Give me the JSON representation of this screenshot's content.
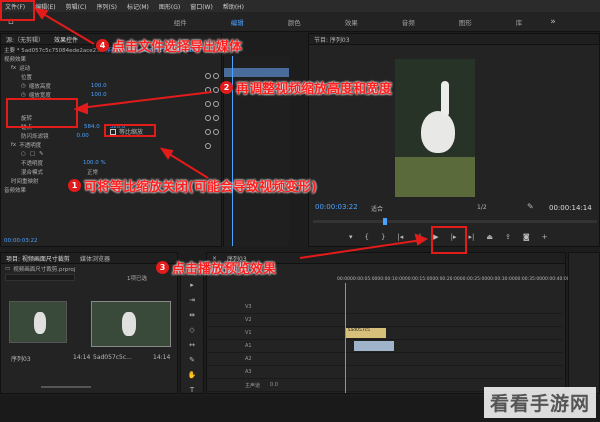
{
  "menu": [
    "文件(F)",
    "编辑(E)",
    "剪辑(C)",
    "序列(S)",
    "标记(M)",
    "图形(G)",
    "窗口(W)",
    "帮助(H)"
  ],
  "workspaces": [
    "组件",
    "编辑",
    "颜色",
    "效果",
    "音频",
    "图形",
    "库"
  ],
  "effects_panel": {
    "tab_source": "源:（无剪辑）",
    "tab_effects": "效果控件",
    "master_label": "主要 * 5ad057c5c75084ede2ace2...",
    "sequence_label": "序列 03 * 5ad057c5c75084edeb...",
    "section_video": "视频效果",
    "motion": "运动",
    "position": "位置",
    "scale_height": "缩放高度",
    "scale_width": "缩放宽度",
    "scale_height_val": "100.0",
    "scale_width_val": "100.0",
    "uniform_scale": "等比缩放",
    "rotation": "旋转",
    "anchor": "锚点",
    "anchor_x": "584.0",
    "anchor_y": "320.0",
    "anti_flicker": "防闪烁滤镜",
    "anti_flicker_val": "0.00",
    "opacity_section": "不透明度",
    "opacity": "不透明度",
    "opacity_val": "100.0 %",
    "blend_mode": "混合模式",
    "blend_val": "正常",
    "time_remap": "时间重映射",
    "audio_effects": "音频效果",
    "timecode": "00:00:03:22"
  },
  "program_monitor": {
    "title": "节目: 序列03",
    "timecode_current": "00:00:03:22",
    "fit": "适合",
    "ratio": "1/2",
    "timecode_total": "00:00:14:14"
  },
  "project_panel": {
    "tab_project": "项目: 视频画面尺寸裁剪",
    "tab_media": "媒体浏览器",
    "file": "视频画面尺寸裁剪.prproj",
    "count": "1项已选",
    "items": [
      {
        "name": "序列03",
        "duration": "14:14"
      },
      {
        "name": "5ad057c5c...",
        "duration": "14:14"
      }
    ]
  },
  "timeline": {
    "title": "序列03",
    "timecode": "00:00:03:22",
    "ruler": [
      "00:00",
      "00:00:05:00",
      "00:00:10:00",
      "00:00:15:00",
      "00:00:20:00",
      "00:00:25:00",
      "00:00:30:00",
      "00:00:35:00",
      "00:00:40:00"
    ],
    "tracks": [
      "V3",
      "V2",
      "V1",
      "A1",
      "A2",
      "A3"
    ],
    "master": "主声道",
    "master_val": "0.0",
    "clip_label": "5ad057c5"
  },
  "annotations": {
    "a1": {
      "num": "1",
      "text": "可将等比缩放关闭(可能会导致视频变形)"
    },
    "a2": {
      "num": "2",
      "text": "再调整视频缩放高度和宽度"
    },
    "a3": {
      "num": "3",
      "text": "点击播放预览效果"
    },
    "a4": {
      "num": "4",
      "text": "点击文件选择导出媒体"
    }
  },
  "watermark": "看看手游网"
}
